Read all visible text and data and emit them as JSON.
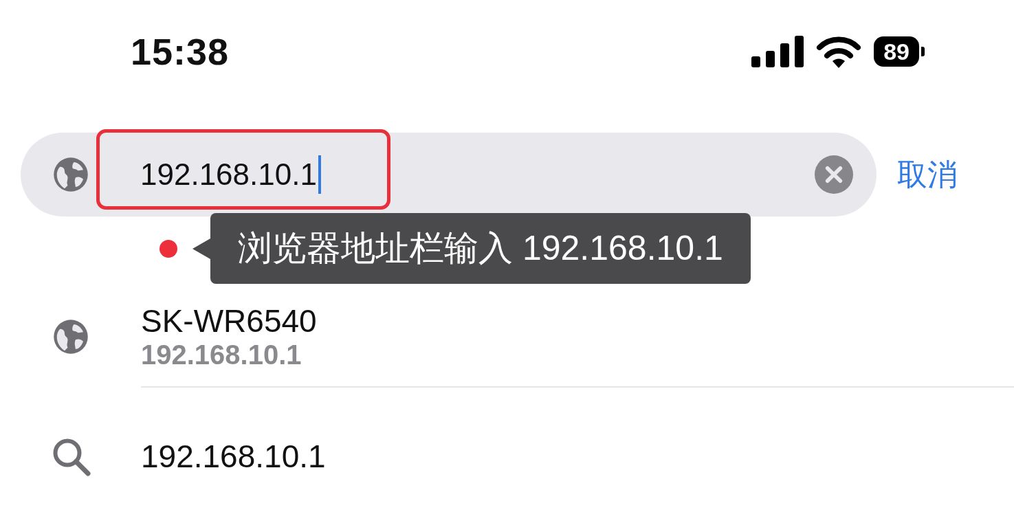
{
  "status_bar": {
    "time": "15:38",
    "battery": "89"
  },
  "address_bar": {
    "value": "192.168.10.1",
    "cancel": "取消",
    "highlighted": true
  },
  "annotation": {
    "text": "浏览器地址栏输入 192.168.10.1"
  },
  "suggestions": [
    {
      "kind": "site",
      "title": "SK-WR6540",
      "subtitle": "192.168.10.1"
    },
    {
      "kind": "search",
      "title": "192.168.10.1"
    }
  ]
}
